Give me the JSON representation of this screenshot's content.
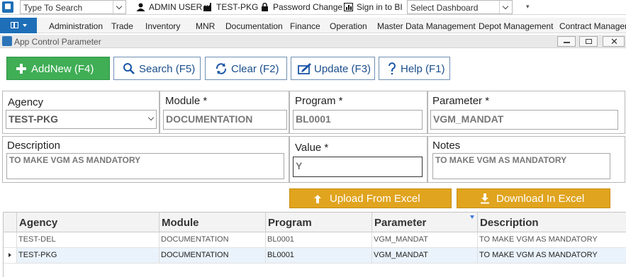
{
  "topbar": {
    "search_placeholder": "Type To Search",
    "user": "ADMIN USER",
    "agency": "TEST-PKG",
    "password_change": "Password Change",
    "sign_in_bi": "Sign in to BI",
    "dashboard_select": "Select Dashboard"
  },
  "menu": {
    "items": [
      "Administration",
      "Trade",
      "Inventory",
      "MNR",
      "Documentation",
      "Finance",
      "Operation",
      "Master Data Management",
      "Depot Management",
      "Contract Manageme"
    ]
  },
  "window": {
    "title": "App Control Parameter"
  },
  "toolbar": {
    "addnew": "AddNew (F4)",
    "search": "Search (F5)",
    "clear": "Clear (F2)",
    "update": "Update (F3)",
    "help": "Help (F1)"
  },
  "form": {
    "agency_label": "Agency",
    "agency_value": "TEST-PKG",
    "module_label": "Module  *",
    "module_value": "DOCUMENTATION",
    "program_label": "Program *",
    "program_value": "BL0001",
    "parameter_label": "Parameter *",
    "parameter_value": "VGM_MANDAT",
    "description_label": "Description",
    "description_value": "TO MAKE VGM AS MANDATORY",
    "value_label": "Value *",
    "value_value": "Y",
    "notes_label": "Notes",
    "notes_value": "TO MAKE VGM AS MANDATORY"
  },
  "excel": {
    "upload": "Upload From Excel",
    "download": "Download In Excel"
  },
  "grid": {
    "columns": [
      "Agency",
      "Module",
      "Program",
      "Parameter",
      "Description"
    ],
    "rows": [
      [
        "TEST-DEL",
        "DOCUMENTATION",
        "BL0001",
        "VGM_MANDAT",
        "TO MAKE VGM AS MANDATORY"
      ],
      [
        "TEST-PKG",
        "DOCUMENTATION",
        "BL0001",
        "VGM_MANDAT",
        "TO MAKE VGM AS MANDATORY"
      ]
    ]
  },
  "colors": {
    "addnew_green": "#3fae55",
    "excel_orange": "#e0a41f",
    "menu_blue": "#1e6fb8",
    "selected_row": "#eaf3fb"
  }
}
